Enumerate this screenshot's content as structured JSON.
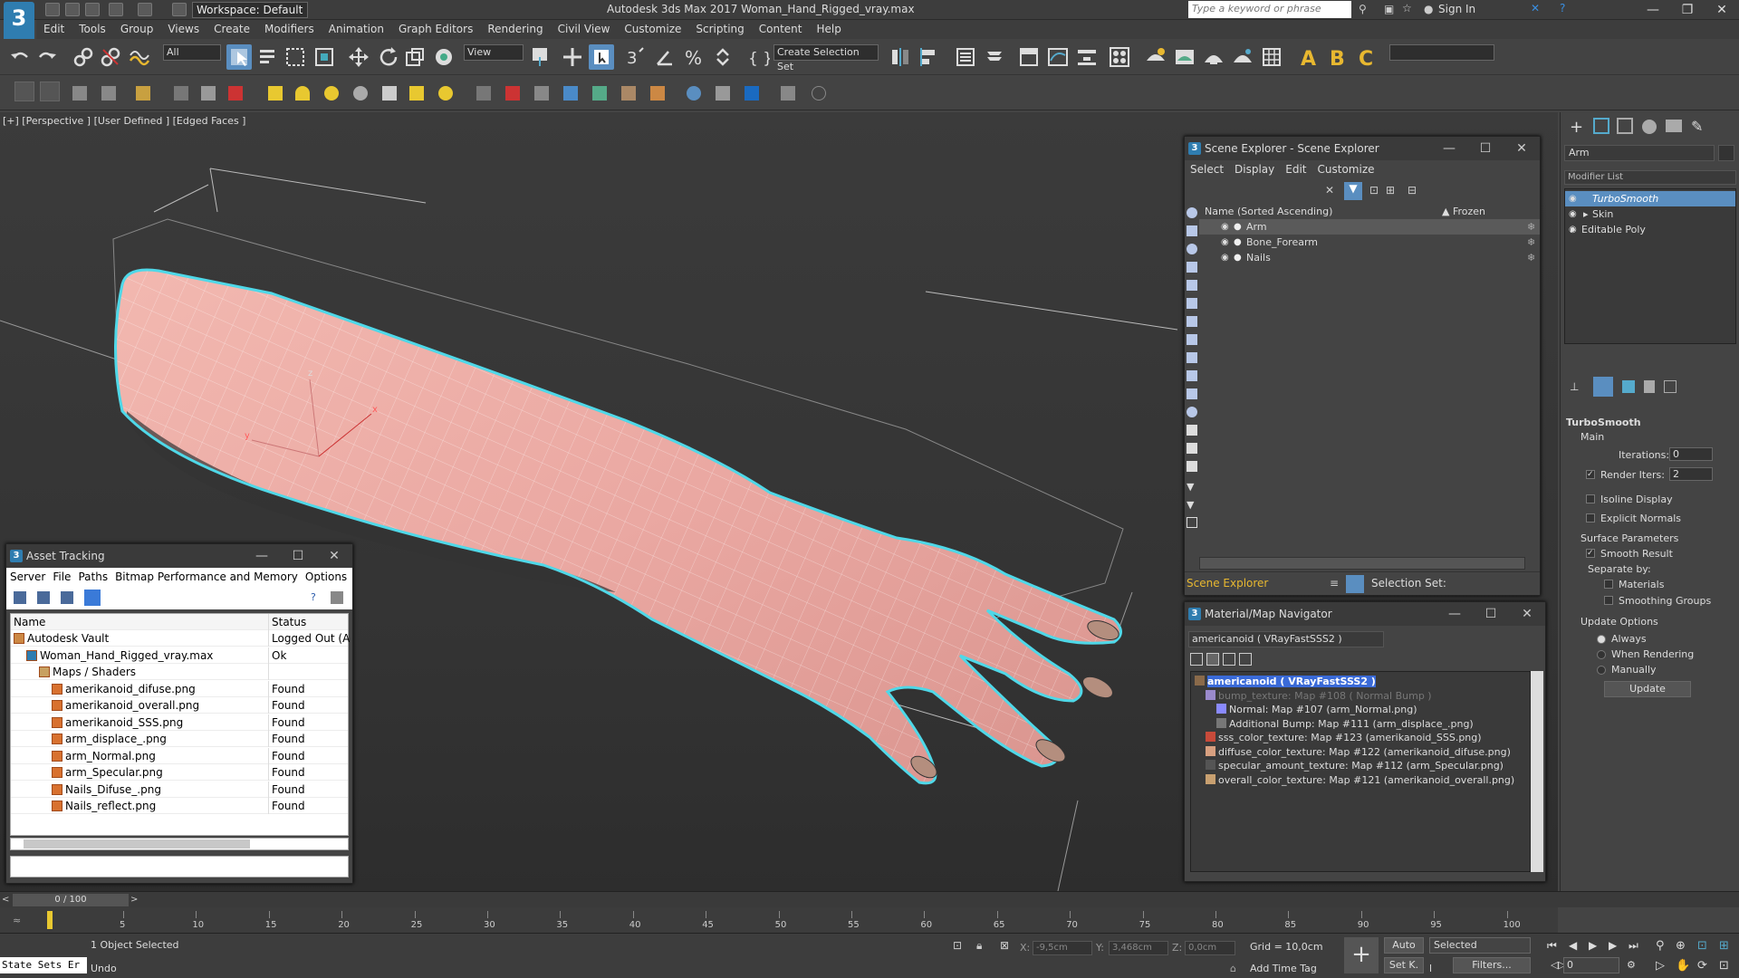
{
  "title_bar": {
    "workspace": "Workspace: Default",
    "app_title": "Autodesk 3ds Max 2017     Woman_Hand_Rigged_vray.max",
    "search_placeholder": "Type a keyword or phrase",
    "sign_in": "Sign In"
  },
  "menus": [
    "Edit",
    "Tools",
    "Group",
    "Views",
    "Create",
    "Modifiers",
    "Animation",
    "Graph Editors",
    "Rendering",
    "Civil View",
    "Customize",
    "Scripting",
    "Content",
    "Help"
  ],
  "toolbar": {
    "selection_filter": "All",
    "ref_coord": "View",
    "create_selection_set": "Create Selection Set"
  },
  "viewport": {
    "label": "[+] [Perspective ] [User Defined ] [Edged Faces ]",
    "gizmo_axes": {
      "x": "x",
      "y": "y",
      "z": "z"
    }
  },
  "scene_explorer": {
    "title": "Scene Explorer - Scene Explorer",
    "menus": [
      "Select",
      "Display",
      "Edit",
      "Customize"
    ],
    "col_name": "Name (Sorted Ascending)",
    "col_frozen": "▲ Frozen",
    "rows": [
      {
        "name": "Arm",
        "selected": true
      },
      {
        "name": "Bone_Forearm",
        "selected": false
      },
      {
        "name": "Nails",
        "selected": false
      }
    ],
    "footer_name": "Scene Explorer",
    "selection_set_label": "Selection Set:"
  },
  "material_navigator": {
    "title": "Material/Map Navigator",
    "current": "americanoid  ( VRayFastSSS2 )",
    "tree": [
      {
        "label": "americanoid  ( VRayFastSSS2 )",
        "level": 0,
        "color": "#8a6a4a",
        "selected": true
      },
      {
        "label": "bump_texture: Map #108  ( Normal Bump )",
        "level": 1,
        "color": "#9a8acc",
        "dim": true
      },
      {
        "label": "Normal: Map #107 (arm_Normal.png)",
        "level": 2,
        "color": "#8a8aff"
      },
      {
        "label": "Additional Bump: Map #111 (arm_displace_.png)",
        "level": 2,
        "color": "#777"
      },
      {
        "label": "sss_color_texture: Map #123 (amerikanoid_SSS.png)",
        "level": 1,
        "color": "#c84a3a"
      },
      {
        "label": "diffuse_color_texture: Map #122 (amerikanoid_difuse.png)",
        "level": 1,
        "color": "#d8a080"
      },
      {
        "label": "specular_amount_texture: Map #112 (arm_Specular.png)",
        "level": 1,
        "color": "#555"
      },
      {
        "label": "overall_color_texture: Map #121 (amerikanoid_overall.png)",
        "level": 1,
        "color": "#c8a070"
      }
    ]
  },
  "asset_tracking": {
    "title": "Asset Tracking",
    "menus": [
      "Server",
      "File",
      "Paths",
      "Bitmap Performance and Memory",
      "Options"
    ],
    "col_name": "Name",
    "col_status": "Status",
    "rows": [
      {
        "name": "Autodesk Vault",
        "status": "Logged Out (Asse",
        "indent": 0,
        "icon": "vault"
      },
      {
        "name": "Woman_Hand_Rigged_vray.max",
        "status": "Ok",
        "indent": 1,
        "icon": "max"
      },
      {
        "name": "Maps / Shaders",
        "status": "",
        "indent": 2,
        "icon": "folder"
      },
      {
        "name": "amerikanoid_difuse.png",
        "status": "Found",
        "indent": 3,
        "icon": "file"
      },
      {
        "name": "amerikanoid_overall.png",
        "status": "Found",
        "indent": 3,
        "icon": "file"
      },
      {
        "name": "amerikanoid_SSS.png",
        "status": "Found",
        "indent": 3,
        "icon": "file"
      },
      {
        "name": "arm_displace_.png",
        "status": "Found",
        "indent": 3,
        "icon": "file"
      },
      {
        "name": "arm_Normal.png",
        "status": "Found",
        "indent": 3,
        "icon": "file"
      },
      {
        "name": "arm_Specular.png",
        "status": "Found",
        "indent": 3,
        "icon": "file"
      },
      {
        "name": "Nails_Difuse_.png",
        "status": "Found",
        "indent": 3,
        "icon": "file"
      },
      {
        "name": "Nails_reflect.png",
        "status": "Found",
        "indent": 3,
        "icon": "file"
      }
    ]
  },
  "command_panel": {
    "object_name": "Arm",
    "modifier_list": "Modifier List",
    "stack": [
      {
        "name": "TurboSmooth",
        "active": true
      },
      {
        "name": "Skin",
        "active": false
      },
      {
        "name": "Editable Poly",
        "active": false
      }
    ],
    "rollout_title": "TurboSmooth",
    "main_label": "Main",
    "iterations_label": "Iterations:",
    "iterations_value": "0",
    "render_iters_label": "Render Iters:",
    "render_iters_value": "2",
    "isoline_display": "Isoline Display",
    "explicit_normals": "Explicit Normals",
    "surface_params": "Surface Parameters",
    "smooth_result": "Smooth Result",
    "separate_by": "Separate by:",
    "materials": "Materials",
    "smoothing_groups": "Smoothing Groups",
    "update_options": "Update Options",
    "always": "Always",
    "when_rendering": "When Rendering",
    "manually": "Manually",
    "update_button": "Update"
  },
  "timeline": {
    "frame_info": "0 / 100",
    "ticks": [
      "5",
      "10",
      "15",
      "20",
      "25",
      "30",
      "35",
      "40",
      "45",
      "50",
      "55",
      "60",
      "65",
      "70",
      "75",
      "80",
      "85",
      "90",
      "95",
      "100"
    ]
  },
  "status_bar": {
    "selected_text": "1 Object Selected",
    "undo_text": "Undo",
    "state_sets": "State Sets Er",
    "x_label": "X:",
    "x_value": "-9,5cm",
    "y_label": "Y:",
    "y_value": "3,468cm",
    "z_label": "Z:",
    "z_value": "0,0cm",
    "grid": "Grid = 10,0cm",
    "add_time_tag": "Add Time Tag",
    "auto": "Auto",
    "set_key": "Set K.",
    "selected_drop": "Selected",
    "filters": "Filters...",
    "frame_field": "0"
  }
}
